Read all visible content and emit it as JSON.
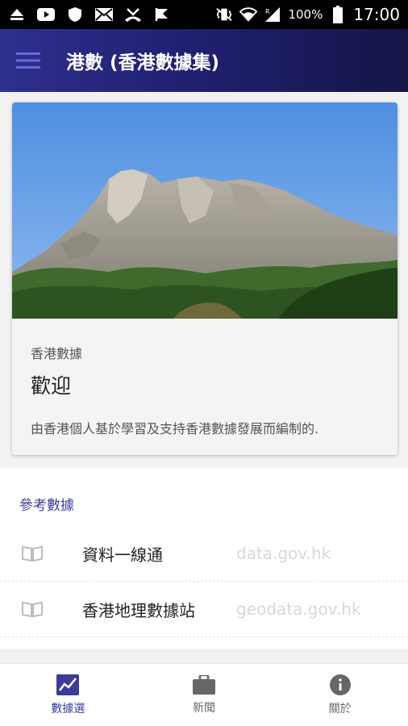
{
  "status_bar": {
    "battery": "100%",
    "time": "17:00"
  },
  "app_bar": {
    "title": "港數 (香港數據集)"
  },
  "welcome_card": {
    "kicker": "香港數據",
    "title": "歡迎",
    "description": "由香港個人基於學習及支持香港數據發展而編制的."
  },
  "references": {
    "header": "參考數據",
    "items": [
      {
        "name": "資料一線通",
        "url": "data.gov.hk"
      },
      {
        "name": "香港地理數據站",
        "url": "geodata.gov.hk"
      }
    ]
  },
  "bottom_nav": {
    "items": [
      {
        "label": "數據選",
        "icon": "chart-icon",
        "active": true
      },
      {
        "label": "新聞",
        "icon": "briefcase-icon",
        "active": false
      },
      {
        "label": "關於",
        "icon": "info-icon",
        "active": false
      }
    ]
  },
  "colors": {
    "app_bar": "#1f1f6e",
    "accent": "#3b3b9a",
    "url_text": "#d8d8d8"
  }
}
